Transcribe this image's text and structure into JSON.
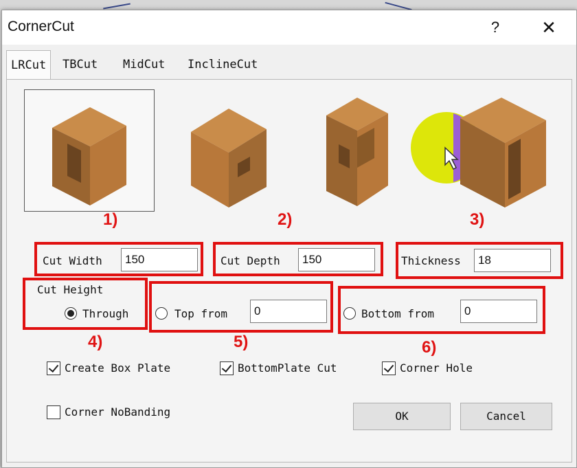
{
  "window": {
    "title": "CornerCut",
    "help_label": "?",
    "close_label": "✕"
  },
  "tabs": [
    {
      "label": "LRCut",
      "active": true
    },
    {
      "label": "TBCut",
      "active": false
    },
    {
      "label": "MidCut",
      "active": false
    },
    {
      "label": "InclineCut",
      "active": false
    }
  ],
  "preview_options": [
    "lr-cut-variant-1",
    "lr-cut-variant-2",
    "lr-cut-variant-3",
    "lr-cut-variant-4"
  ],
  "annotations": [
    "1)",
    "2)",
    "3)",
    "4)",
    "5)",
    "6)"
  ],
  "fields": {
    "cut_width": {
      "label": "Cut Width",
      "value": "150"
    },
    "cut_depth": {
      "label": "Cut Depth",
      "value": "150"
    },
    "thickness": {
      "label": "Thickness",
      "value": "18"
    }
  },
  "cut_height": {
    "label": "Cut Height",
    "through_label": "Through",
    "top_from_label": "Top from",
    "top_from_value": "0",
    "bottom_from_label": "Bottom from",
    "bottom_from_value": "0",
    "selected": "Through"
  },
  "checkboxes": {
    "create_box_plate": {
      "label": "Create Box Plate",
      "checked": true
    },
    "bottomplate_cut": {
      "label": "BottomPlate Cut",
      "checked": true
    },
    "corner_hole": {
      "label": "Corner Hole",
      "checked": true
    },
    "corner_nobanding": {
      "label": "Corner NoBanding",
      "checked": false
    }
  },
  "buttons": {
    "ok": "OK",
    "cancel": "Cancel"
  },
  "colors": {
    "annotation_red": "#e01010",
    "wood": "#b8783a",
    "highlight_yellow": "#dde60a",
    "highlight_purple": "#9b5fd6"
  }
}
